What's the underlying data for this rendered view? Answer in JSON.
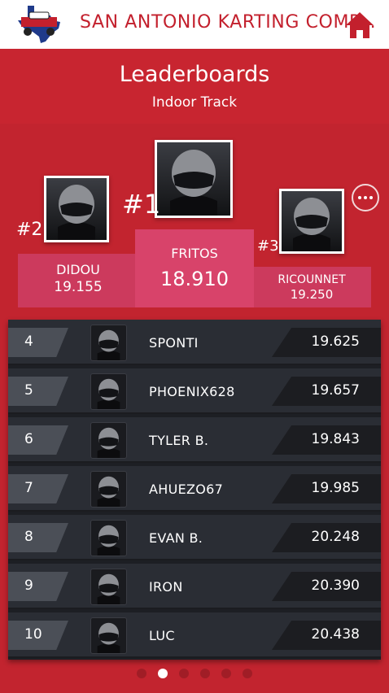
{
  "app": {
    "title": "SAN ANTONIO KARTING COMP...",
    "brand_color": "#c3202d",
    "logo_icon": "texas-karting-logo",
    "home_icon": "home-icon"
  },
  "page": {
    "title": "Leaderboards",
    "subtitle": "Indoor Track",
    "more_icon": "more-options-icon"
  },
  "podium": [
    {
      "rank": "#1",
      "name": "FRITOS",
      "time": "18.910"
    },
    {
      "rank": "#2",
      "name": "DIDOU",
      "time": "19.155"
    },
    {
      "rank": "#3",
      "name": "RICOUNNET",
      "time": "19.250"
    }
  ],
  "leaderboard": [
    {
      "rank": "4",
      "name": "SPONTI",
      "time": "19.625"
    },
    {
      "rank": "5",
      "name": "PHOENIX628",
      "time": "19.657"
    },
    {
      "rank": "6",
      "name": "TYLER B.",
      "time": "19.843"
    },
    {
      "rank": "7",
      "name": "AHUEZO67",
      "time": "19.985"
    },
    {
      "rank": "8",
      "name": "EVAN B.",
      "time": "20.248"
    },
    {
      "rank": "9",
      "name": "IRON",
      "time": "20.390"
    },
    {
      "rank": "10",
      "name": "LUC",
      "time": "20.438"
    }
  ],
  "pager": {
    "count": 6,
    "active_index": 1
  }
}
